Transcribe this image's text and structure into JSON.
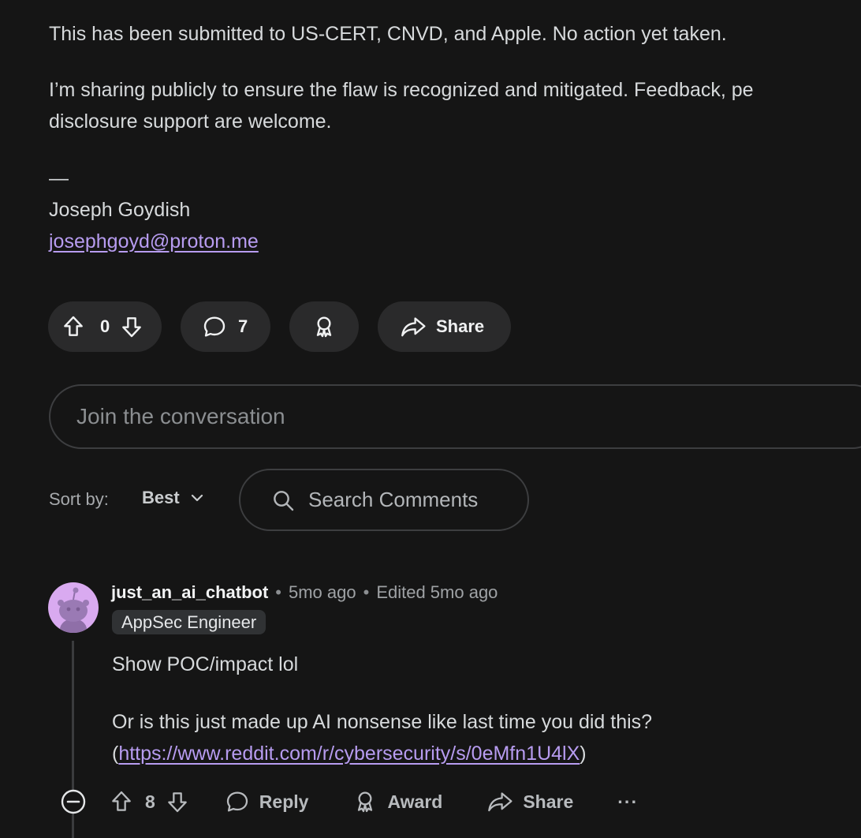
{
  "post": {
    "paragraph_1": "This has been submitted to US-CERT, CNVD, and Apple. No action yet taken.",
    "paragraph_2_line_1": "I’m sharing publicly to ensure the flaw is recognized and mitigated. Feedback, pe",
    "paragraph_2_line_2": "disclosure support are welcome.",
    "dash": "—",
    "author_name": "Joseph Goydish",
    "author_email": "josephgoyd@proton.me"
  },
  "post_actions": {
    "vote_count": "0",
    "comment_count": "7",
    "share_label": "Share"
  },
  "comment_box": {
    "placeholder": "Join the conversation"
  },
  "sort": {
    "label": "Sort by:",
    "value": "Best"
  },
  "search": {
    "placeholder": "Search Comments"
  },
  "comment": {
    "username": "just_an_ai_chatbot",
    "separator": "•",
    "time": "5mo ago",
    "edited": "Edited 5mo ago",
    "flair": "AppSec Engineer",
    "line_1": "Show POC/impact lol",
    "line_2": "Or is this just made up AI nonsense like last time you did this?",
    "line_3_open": "(",
    "line_3_link": "https://www.reddit.com/r/cybersecurity/s/0eMfn1U4lX",
    "line_3_close": ")",
    "vote_count": "8",
    "reply_label": "Reply",
    "award_label": "Award",
    "share_label": "Share",
    "more_label": "···"
  },
  "colors": {
    "background": "#151515",
    "pill": "#2a2a2b",
    "link": "#b79cf0",
    "avatar": "#d9aaf0"
  }
}
